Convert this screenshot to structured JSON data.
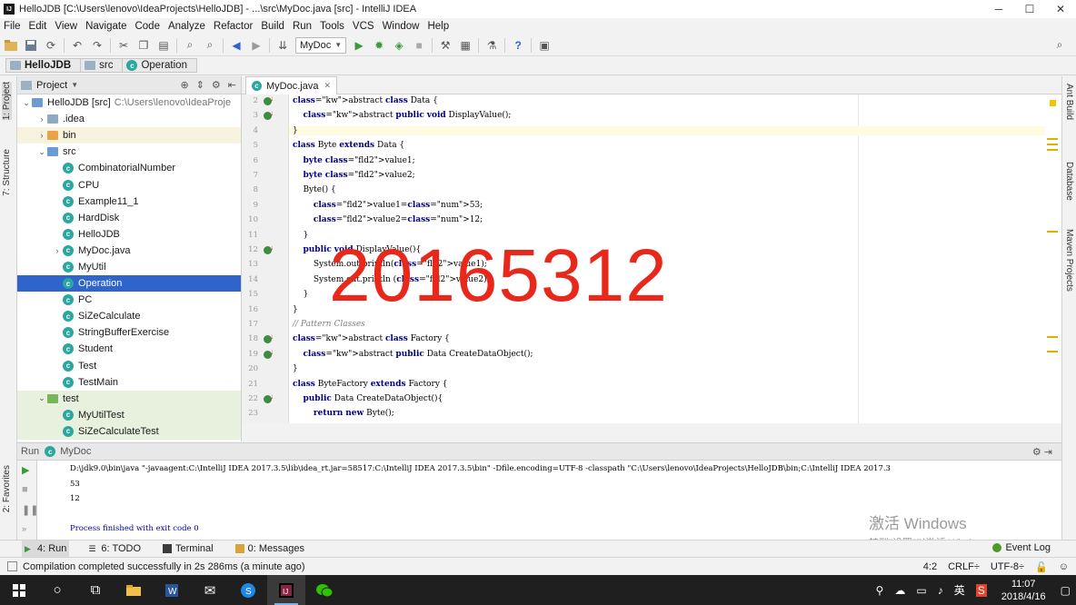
{
  "window": {
    "title": "HelloJDB [C:\\Users\\lenovo\\IdeaProjects\\HelloJDB] - ...\\src\\MyDoc.java [src] - IntelliJ IDEA",
    "logo_text": "IJ",
    "controls": [
      "─",
      "☐",
      "✕"
    ]
  },
  "menu": [
    "File",
    "Edit",
    "View",
    "Navigate",
    "Code",
    "Analyze",
    "Refactor",
    "Build",
    "Run",
    "Tools",
    "VCS",
    "Window",
    "Help"
  ],
  "toolbar": {
    "run_config": "MyDoc"
  },
  "breadcrumbs": [
    "HelloJDB",
    "src",
    "Operation"
  ],
  "left_strip": {
    "project_tab": "1: Project",
    "structure_tab": "7: Structure",
    "favorites_tab": "2: Favorites"
  },
  "right_strip": {
    "ant": "Ant Build",
    "database": "Database",
    "maven": "Maven Projects"
  },
  "project_panel": {
    "title": "Project",
    "tree": [
      {
        "label": "HelloJDB [src]",
        "path": "C:\\Users\\lenovo\\IdeaProje",
        "indent": 0,
        "arrow": "⌄",
        "icon": "folder-blue",
        "state": ""
      },
      {
        "label": ".idea",
        "indent": 1,
        "arrow": "›",
        "icon": "folder",
        "state": ""
      },
      {
        "label": "bin",
        "indent": 1,
        "arrow": "›",
        "icon": "folder-orange",
        "state": "hl"
      },
      {
        "label": "src",
        "indent": 1,
        "arrow": "⌄",
        "icon": "folder-blue",
        "state": ""
      },
      {
        "label": "CombinatorialNumber",
        "indent": 2,
        "arrow": "",
        "icon": "class",
        "state": ""
      },
      {
        "label": "CPU",
        "indent": 2,
        "arrow": "",
        "icon": "class",
        "state": ""
      },
      {
        "label": "Example11_1",
        "indent": 2,
        "arrow": "",
        "icon": "class",
        "state": ""
      },
      {
        "label": "HardDisk",
        "indent": 2,
        "arrow": "",
        "icon": "class",
        "state": ""
      },
      {
        "label": "HelloJDB",
        "indent": 2,
        "arrow": "",
        "icon": "class",
        "state": ""
      },
      {
        "label": "MyDoc.java",
        "indent": 2,
        "arrow": "›",
        "icon": "class",
        "state": ""
      },
      {
        "label": "MyUtil",
        "indent": 2,
        "arrow": "",
        "icon": "class",
        "state": ""
      },
      {
        "label": "Operation",
        "indent": 2,
        "arrow": "",
        "icon": "class",
        "state": "sel"
      },
      {
        "label": "PC",
        "indent": 2,
        "arrow": "",
        "icon": "class",
        "state": ""
      },
      {
        "label": "SiZeCalculate",
        "indent": 2,
        "arrow": "",
        "icon": "class",
        "state": ""
      },
      {
        "label": "StringBufferExercise",
        "indent": 2,
        "arrow": "",
        "icon": "class",
        "state": ""
      },
      {
        "label": "Student",
        "indent": 2,
        "arrow": "",
        "icon": "class",
        "state": ""
      },
      {
        "label": "Test",
        "indent": 2,
        "arrow": "",
        "icon": "class",
        "state": ""
      },
      {
        "label": "TestMain",
        "indent": 2,
        "arrow": "",
        "icon": "class",
        "state": ""
      },
      {
        "label": "test",
        "indent": 1,
        "arrow": "⌄",
        "icon": "folder-green",
        "state": "test"
      },
      {
        "label": "MyUtilTest",
        "indent": 2,
        "arrow": "",
        "icon": "class",
        "state": "test"
      },
      {
        "label": "SiZeCalculateTest",
        "indent": 2,
        "arrow": "",
        "icon": "class",
        "state": "test"
      }
    ]
  },
  "editor": {
    "tab": "MyDoc.java",
    "overlay_text": "20165312",
    "lines": [
      {
        "n": "2",
        "mark": true
      },
      {
        "n": "3",
        "mark": true
      },
      {
        "n": "4",
        "mark": false
      },
      {
        "n": "5",
        "mark": false
      },
      {
        "n": "6",
        "mark": false
      },
      {
        "n": "7",
        "mark": false
      },
      {
        "n": "8",
        "mark": false
      },
      {
        "n": "9",
        "mark": false
      },
      {
        "n": "10",
        "mark": false
      },
      {
        "n": "11",
        "mark": false
      },
      {
        "n": "12",
        "mark": true
      },
      {
        "n": "13",
        "mark": false
      },
      {
        "n": "14",
        "mark": false
      },
      {
        "n": "15",
        "mark": false
      },
      {
        "n": "16",
        "mark": false
      },
      {
        "n": "17",
        "mark": false
      },
      {
        "n": "18",
        "mark": true
      },
      {
        "n": "19",
        "mark": true
      },
      {
        "n": "20",
        "mark": false
      },
      {
        "n": "21",
        "mark": false
      },
      {
        "n": "22",
        "mark": true
      },
      {
        "n": "23",
        "mark": false
      }
    ],
    "code": [
      "abstract class Data {",
      "    abstract public void DisplayValue();",
      "}",
      "class Byte extends Data {",
      "    byte value1;",
      "    byte value2;",
      "    Byte() {",
      "        value1=53;",
      "        value2=12;",
      "    }",
      "    public void DisplayValue(){",
      "        System.out.println(value1);",
      "        System.out.println (value2);",
      "    }",
      "}",
      "// Pattern Classes",
      "abstract class Factory {",
      "    abstract public Data CreateDataObject();",
      "}",
      "class ByteFactory extends Factory {",
      "    public Data CreateDataObject(){",
      "        return new Byte();"
    ]
  },
  "run_panel": {
    "label": "Run",
    "config": "MyDoc",
    "console": [
      "D:\\jdk9.0\\bin\\java \"-javaagent:C:\\IntelliJ IDEA 2017.3.5\\lib\\idea_rt.jar=58517:C:\\IntelliJ IDEA 2017.3.5\\bin\" -Dfile.encoding=UTF-8 -classpath \"C:\\Users\\lenovo\\IdeaProjects\\HelloJDB\\bin;C:\\IntelliJ IDEA 2017.3",
      "53",
      "12",
      "",
      "Process finished with exit code 0"
    ]
  },
  "watermark": {
    "line1": "激活 Windows",
    "line2": "转到\"设置\"以激活 Windows。"
  },
  "tool_windows": [
    {
      "label": "4: Run",
      "active": true
    },
    {
      "label": "6: TODO",
      "active": false
    },
    {
      "label": "Terminal",
      "active": false
    },
    {
      "label": "0: Messages",
      "active": false
    }
  ],
  "event_log": "Event Log",
  "status": {
    "message": "Compilation completed successfully in 2s 286ms (a minute ago)",
    "position": "4:2",
    "line_sep": "CRLF÷",
    "encoding": "UTF-8÷"
  },
  "taskbar": {
    "time": "11:07",
    "date": "2018/4/16",
    "ime": "英"
  },
  "colors": {
    "selection": "#2f65ca",
    "overlay": "#e8281b",
    "keyword": "#000080",
    "field": "#660e7a",
    "number": "#0000ff"
  }
}
